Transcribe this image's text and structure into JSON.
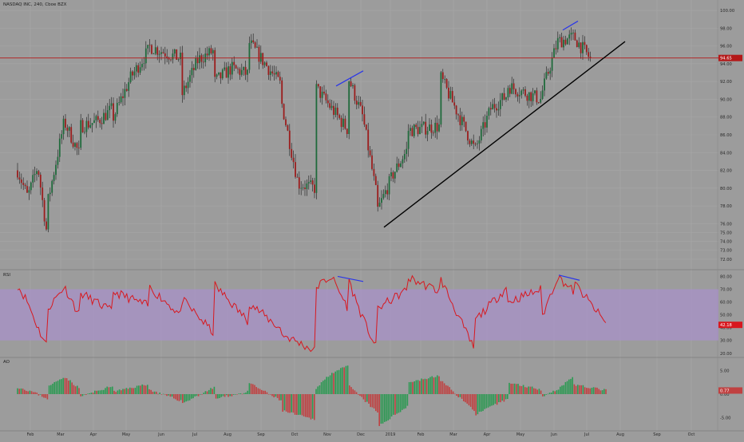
{
  "header": {
    "symbol_title": "NASDAQ INC, 240, Cboe BZX"
  },
  "indicators": {
    "rsi_label": "RSI",
    "ao_label": "AO"
  },
  "colors": {
    "background": "#9c9c9c",
    "candle_up": "#1f6a3b",
    "candle_down": "#9b1d1d",
    "rsi_line": "#d8181f",
    "rsi_band": "#a892c8",
    "price_line": "#b41818",
    "divergence": "#2a36e8",
    "trendline": "#000000",
    "ao_up": "#2b9a52",
    "ao_down": "#c04141"
  },
  "chart_data": [
    {
      "type": "candlestick",
      "panel": "price",
      "y_ticks": [
        "100.00",
        "98.00",
        "96.00",
        "94.00",
        "92.00",
        "90.00",
        "88.00",
        "86.00",
        "84.00",
        "82.00",
        "80.00",
        "78.00",
        "76.00",
        "75.00",
        "74.00",
        "73.00",
        "72.00"
      ],
      "x_ticks": [
        "Feb",
        "Mar",
        "Apr",
        "May",
        "Jun",
        "Jul",
        "Aug",
        "Sep",
        "Oct",
        "Nov",
        "Dec",
        "2019",
        "Feb",
        "Mar",
        "Apr",
        "May",
        "Jun",
        "Jul",
        "Aug",
        "Sep",
        "Oct"
      ],
      "last_price_label": "94.65",
      "ylim": [
        71,
        101
      ],
      "path": [
        [
          "Feb",
          82.0
        ],
        [
          "Feb",
          79.0
        ],
        [
          "Feb",
          82.5
        ],
        [
          "Feb",
          74.0
        ],
        [
          "Mar",
          78.5
        ],
        [
          "Mar",
          87.5
        ],
        [
          "Mar",
          83.5
        ],
        [
          "Apr",
          87.0
        ],
        [
          "Apr",
          87.5
        ],
        [
          "Apr",
          89.0
        ],
        [
          "May",
          88.0
        ],
        [
          "May",
          92.5
        ],
        [
          "May",
          95.5
        ],
        [
          "Jun",
          96.0
        ],
        [
          "Jun",
          94.5
        ],
        [
          "Jul",
          90.5
        ],
        [
          "Jul",
          94.5
        ],
        [
          "Jul",
          95.5
        ],
        [
          "Aug",
          92.0
        ],
        [
          "Aug",
          93.5
        ],
        [
          "Aug",
          92.8
        ],
        [
          "Sep",
          96.5
        ],
        [
          "Sep",
          91.5
        ],
        [
          "Oct",
          89.5
        ],
        [
          "Oct",
          80.5
        ],
        [
          "Oct",
          80.0
        ],
        [
          "Nov",
          91.5
        ],
        [
          "Nov",
          86.5
        ],
        [
          "Dec",
          92.5
        ],
        [
          "Dec",
          88.0
        ],
        [
          "Dec",
          78.5
        ],
        [
          "2019",
          77.5
        ],
        [
          "2019",
          81.5
        ],
        [
          "2019",
          84.5
        ],
        [
          "Feb",
          86.5
        ],
        [
          "Feb",
          87.0
        ],
        [
          "Mar",
          92.5
        ],
        [
          "Mar",
          84.5
        ],
        [
          "Apr",
          84.0
        ],
        [
          "Apr",
          89.0
        ],
        [
          "Apr",
          90.5
        ],
        [
          "May",
          91.5
        ],
        [
          "May",
          90.0
        ],
        [
          "Jun",
          90.5
        ],
        [
          "Jun",
          96.5
        ],
        [
          "Jun",
          97.0
        ],
        [
          "Jul",
          94.5
        ]
      ],
      "annotations": {
        "horizontal_line": 94.65,
        "divergence_1": [
          [
            "Nov",
            91.5
          ],
          [
            "Dec",
            93.2
          ]
        ],
        "divergence_2": [
          [
            "Jun",
            97.8
          ],
          [
            "Jun",
            98.8
          ]
        ],
        "trendline": [
          [
            "Dec",
            75.6
          ],
          [
            "Aug",
            96.5
          ]
        ]
      }
    },
    {
      "type": "line",
      "panel": "rsi",
      "name": "RSI",
      "y_ticks": [
        "80.00",
        "70.00",
        "60.00",
        "50.00",
        "40.00",
        "30.00",
        "20.00"
      ],
      "last_value_label": "42.18",
      "band": [
        30,
        70
      ],
      "ylim": [
        18,
        84
      ],
      "path": [
        [
          "Feb",
          73
        ],
        [
          "Feb",
          60
        ],
        [
          "Feb",
          40
        ],
        [
          "Feb",
          24
        ],
        [
          "Mar",
          55
        ],
        [
          "Mar",
          72
        ],
        [
          "Mar",
          48
        ],
        [
          "Apr",
          67
        ],
        [
          "Apr",
          52
        ],
        [
          "May",
          68
        ],
        [
          "May",
          57
        ],
        [
          "Jun",
          72
        ],
        [
          "Jun",
          49
        ],
        [
          "Jul",
          62
        ],
        [
          "Jul",
          35
        ],
        [
          "Aug",
          73
        ],
        [
          "Aug",
          45
        ],
        [
          "Sep",
          60
        ],
        [
          "Sep",
          38
        ],
        [
          "Oct",
          35
        ],
        [
          "Oct",
          22
        ],
        [
          "Nov",
          71
        ],
        [
          "Nov",
          80
        ],
        [
          "Nov",
          55
        ],
        [
          "Dec",
          78
        ],
        [
          "Dec",
          47
        ],
        [
          "Dec",
          22
        ],
        [
          "2019",
          55
        ],
        [
          "2019",
          70
        ],
        [
          "Feb",
          79
        ],
        [
          "Feb",
          68
        ],
        [
          "Mar",
          78
        ],
        [
          "Mar",
          23
        ],
        [
          "Apr",
          45
        ],
        [
          "Apr",
          72
        ],
        [
          "May",
          60
        ],
        [
          "May",
          70
        ],
        [
          "Jun",
          47
        ],
        [
          "Jun",
          80
        ],
        [
          "Jun",
          68
        ],
        [
          "Jul",
          75
        ],
        [
          "Jul",
          42
        ]
      ],
      "divergence_1": [
        [
          "Nov",
          80
        ],
        [
          "Dec",
          76
        ]
      ],
      "divergence_2": [
        [
          "Jun",
          81
        ],
        [
          "Jun",
          77
        ]
      ]
    },
    {
      "type": "histogram",
      "panel": "ao",
      "name": "AO",
      "y_ticks": [
        "5.00",
        "0.00",
        "-5.00"
      ],
      "last_value_label": "0.77",
      "ylim": [
        -7.5,
        7.5
      ],
      "path": [
        [
          "Feb",
          1.5
        ],
        [
          "Feb",
          0.5
        ],
        [
          "Feb",
          -1.0
        ],
        [
          "Mar",
          1.5
        ],
        [
          "Mar",
          3.8
        ],
        [
          "Mar",
          1.0
        ],
        [
          "Apr",
          -0.5
        ],
        [
          "Apr",
          1.8
        ],
        [
          "May",
          0.5
        ],
        [
          "May",
          2.2
        ],
        [
          "Jun",
          1.0
        ],
        [
          "Jun",
          -1.5
        ],
        [
          "Jul",
          -2.0
        ],
        [
          "Jul",
          1.5
        ],
        [
          "Aug",
          -1.0
        ],
        [
          "Aug",
          0.5
        ],
        [
          "Sep",
          2.5
        ],
        [
          "Sep",
          -1.5
        ],
        [
          "Oct",
          -3.5
        ],
        [
          "Oct",
          -5.5
        ],
        [
          "Nov",
          1.0
        ],
        [
          "Nov",
          4.5
        ],
        [
          "Nov",
          6.0
        ],
        [
          "Dec",
          2.0
        ],
        [
          "Dec",
          -4.0
        ],
        [
          "2019",
          -7.0
        ],
        [
          "2019",
          -2.5
        ],
        [
          "Feb",
          2.5
        ],
        [
          "Feb",
          4.0
        ],
        [
          "Mar",
          3.0
        ],
        [
          "Mar",
          -3.5
        ],
        [
          "Apr",
          -4.5
        ],
        [
          "Apr",
          -1.0
        ],
        [
          "May",
          2.5
        ],
        [
          "May",
          1.0
        ],
        [
          "Jun",
          -0.5
        ],
        [
          "Jun",
          1.0
        ],
        [
          "Jun",
          4.0
        ],
        [
          "Jul",
          2.0
        ],
        [
          "Jul",
          0.77
        ]
      ]
    }
  ]
}
